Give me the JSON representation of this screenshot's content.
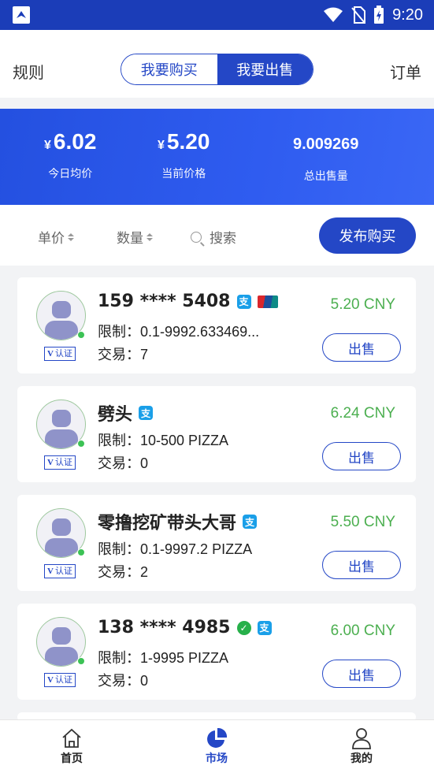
{
  "status_bar": {
    "time": "9:20"
  },
  "nav": {
    "rules": "规则",
    "orders": "订单",
    "segment_buy": "我要购买",
    "segment_sell": "我要出售"
  },
  "stats": {
    "currency_symbol": "¥",
    "avg_price_value": "6.02",
    "avg_price_label": "今日均价",
    "current_price_value": "5.20",
    "current_price_label": "当前价格",
    "total_sold_value": "9.009269",
    "total_sold_label": "总出售量"
  },
  "filter": {
    "unit_price": "单价",
    "quantity": "数量",
    "search": "搜索",
    "publish_button": "发布购买"
  },
  "listings": [
    {
      "name": "159 **** 5408",
      "payments": [
        "alipay-icon",
        "unionpay-icon"
      ],
      "limit": "限制：0.1-9992.633469...",
      "trades": "交易：7",
      "price": "5.20 CNY",
      "sell": "出售",
      "verified": "认证"
    },
    {
      "name": "劈头",
      "payments": [
        "alipay-icon"
      ],
      "limit": "限制：10-500 PIZZA",
      "trades": "交易：0",
      "price": "6.24 CNY",
      "sell": "出售",
      "verified": "认证"
    },
    {
      "name": "零撸挖矿带头大哥",
      "payments": [
        "alipay-icon"
      ],
      "limit": "限制：0.1-9997.2 PIZZA",
      "trades": "交易：2",
      "price": "5.50 CNY",
      "sell": "出售",
      "verified": "认证"
    },
    {
      "name": "138 **** 4985",
      "payments": [
        "wechat-pay-icon",
        "alipay-icon"
      ],
      "limit": "限制：1-9995 PIZZA",
      "trades": "交易：0",
      "price": "6.00 CNY",
      "sell": "出售",
      "verified": "认证"
    }
  ],
  "tabbar": {
    "home": "首页",
    "market": "市场",
    "mine": "我的"
  },
  "colors": {
    "primary": "#2447c6",
    "price_green": "#4caf50",
    "online_dot": "#3cc255"
  }
}
